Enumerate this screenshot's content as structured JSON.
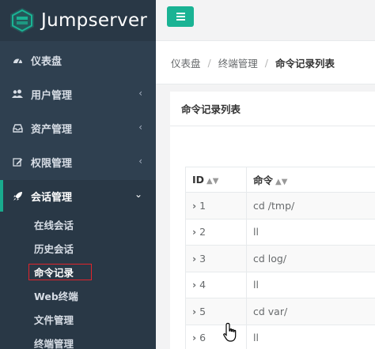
{
  "app": {
    "logo_text": "Jumpserver"
  },
  "sidebar": {
    "items": [
      {
        "label": "仪表盘",
        "icon": "dashboard-icon",
        "has_submenu": false
      },
      {
        "label": "用户管理",
        "icon": "users-icon",
        "has_submenu": true
      },
      {
        "label": "资产管理",
        "icon": "inbox-icon",
        "has_submenu": true
      },
      {
        "label": "权限管理",
        "icon": "edit-icon",
        "has_submenu": true
      },
      {
        "label": "会话管理",
        "icon": "rocket-icon",
        "has_submenu": true,
        "expanded": true
      }
    ],
    "submenu": [
      {
        "label": "在线会话"
      },
      {
        "label": "历史会话"
      },
      {
        "label": "命令记录",
        "selected": true
      },
      {
        "label": "Web终端"
      },
      {
        "label": "文件管理"
      },
      {
        "label": "终端管理"
      }
    ]
  },
  "breadcrumb": {
    "items": [
      "仪表盘",
      "终端管理",
      "命令记录列表"
    ]
  },
  "panel": {
    "title": "命令记录列表"
  },
  "table": {
    "headers": [
      "ID",
      "命令"
    ],
    "rows": [
      {
        "id": "1",
        "command": "cd /tmp/"
      },
      {
        "id": "2",
        "command": "ll"
      },
      {
        "id": "3",
        "command": "cd log/"
      },
      {
        "id": "4",
        "command": "ll"
      },
      {
        "id": "5",
        "command": "cd var/"
      },
      {
        "id": "6",
        "command": "ll"
      }
    ]
  },
  "colors": {
    "sidebar": "#2f4050",
    "accent": "#1ab394",
    "highlight_border": "#e0242b"
  }
}
